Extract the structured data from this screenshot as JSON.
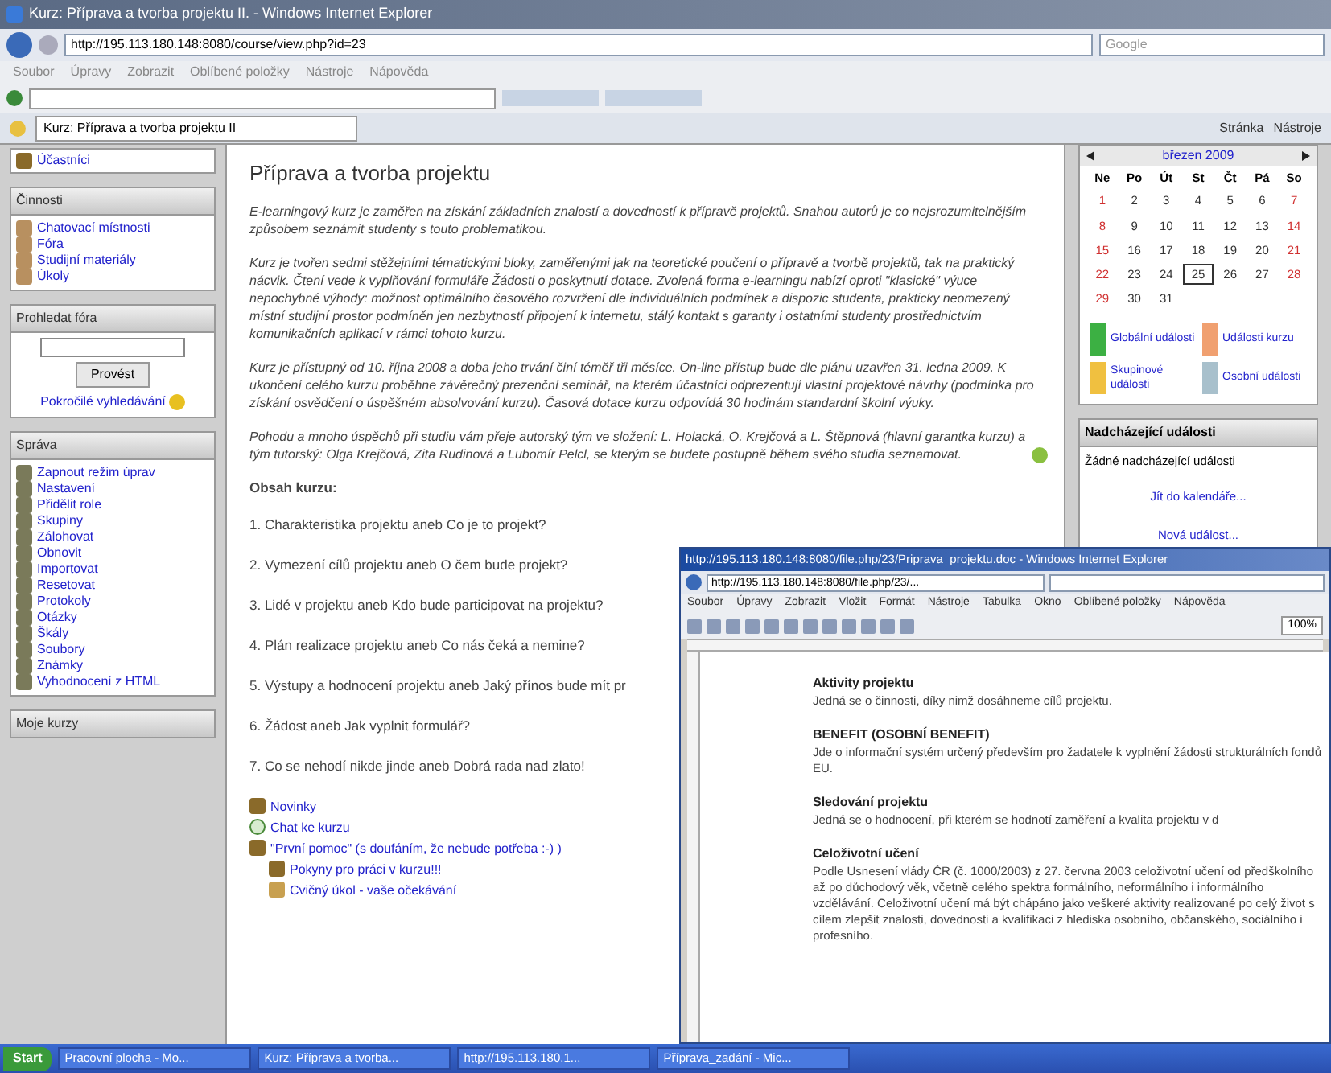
{
  "browser": {
    "title": "Kurz: Příprava a tvorba projektu II. - Windows Internet Explorer",
    "address": "http://195.113.180.148:8080/course/view.php?id=23",
    "search_placeholder": "Google",
    "menu": [
      "Soubor",
      "Úpravy",
      "Zobrazit",
      "Oblíbené položky",
      "Nástroje",
      "Nápověda"
    ],
    "tab": "Kurz: Příprava a tvorba projektu II",
    "command_bar": [
      "Stránka",
      "Nástroje"
    ]
  },
  "left": {
    "top_link": "Účastníci",
    "activities": {
      "title": "Činnosti",
      "items": [
        "Chatovací místnosti",
        "Fóra",
        "Studijní materiály",
        "Úkoly"
      ]
    },
    "search": {
      "title": "Prohledat fóra",
      "button": "Provést",
      "advanced": "Pokročilé vyhledávání"
    },
    "admin": {
      "title": "Správa",
      "items": [
        "Zapnout režim úprav",
        "Nastavení",
        "Přidělit role",
        "Skupiny",
        "Zálohovat",
        "Obnovit",
        "Importovat",
        "Resetovat",
        "Protokoly",
        "Otázky",
        "Škály",
        "Soubory",
        "Známky",
        "Vyhodnocení z HTML"
      ]
    },
    "my_courses": {
      "title": "Moje kurzy"
    }
  },
  "main": {
    "title": "Příprava a tvorba projektu",
    "paragraphs": [
      "E-learningový kurz je zaměřen na získání základních znalostí a dovedností k přípravě projektů. Snahou autorů je co nejsrozumitelnějším způsobem seznámit studenty s touto problematikou.",
      "Kurz je tvořen sedmi stěžejními tématickými bloky, zaměřenými jak na teoretické poučení o přípravě a tvorbě projektů, tak na praktický nácvik. Čtení vede k vyplňování formuláře Žádosti o poskytnutí dotace. Zvolená forma e-learningu nabízí oproti \"klasické\" výuce nepochybné výhody: možnost optimálního časového rozvržení dle individuálních podmínek a dispozic studenta, prakticky neomezený místní studijní prostor podmíněn jen nezbytností připojení k internetu, stálý kontakt s garanty i ostatními studenty prostřednictvím komunikačních aplikací v rámci tohoto kurzu.",
      "Kurz je přístupný od 10. října 2008 a doba jeho trvání činí téměř tři měsíce. On-line přístup bude dle plánu uzavřen 31. ledna 2009. K ukončení celého kurzu proběhne závěrečný prezenční seminář, na kterém účastníci odprezentují vlastní projektové návrhy (podmínka pro získání osvědčení o úspěšném absolvování kurzu). Časová dotace kurzu odpovídá 30 hodinám standardní školní výuky.",
      "Pohodu a mnoho úspěchů při studiu vám přeje autorský tým ve složení: L. Holacká, O. Krejčová a L. Štěpnová (hlavní garantka kurzu) a tým tutorský: Olga Krejčová, Zita Rudinová a Lubomír Pelcl, se kterým se budete postupně během svého studia seznamovat."
    ],
    "contents_title": "Obsah kurzu:",
    "topics": [
      "1. Charakteristika projektu aneb Co je to projekt?",
      "2. Vymezení cílů projektu aneb O čem bude projekt?",
      "3. Lidé v projektu aneb Kdo bude participovat na projektu?",
      "4. Plán realizace projektu aneb Co nás čeká a nemine?",
      "5. Výstupy a hodnocení projektu aneb Jaký přínos bude mít pr",
      "6. Žádost aneb Jak vyplnit formulář?",
      "7. Co se nehodí nikde jinde aneb Dobrá rada nad zlato!"
    ],
    "resources": [
      {
        "kind": "forum",
        "label": "Novinky"
      },
      {
        "kind": "chat",
        "label": "Chat ke kurzu"
      },
      {
        "kind": "forum",
        "label": "\"První pomoc\" (s doufáním, že nebude potřeba :-) )",
        "children": [
          {
            "kind": "forum",
            "label": "Pokyny pro práci v kurzu!!!"
          },
          {
            "kind": "assignment",
            "label": "Cvičný úkol - vaše očekávání"
          }
        ]
      }
    ]
  },
  "calendar": {
    "month": "březen 2009",
    "weekdays": [
      "Ne",
      "Po",
      "Út",
      "St",
      "Čt",
      "Pá",
      "So"
    ],
    "days": [
      {
        "d": "1",
        "weekend": true,
        "today": false
      },
      {
        "d": "2",
        "weekend": false,
        "today": false
      },
      {
        "d": "3",
        "weekend": false,
        "today": false
      },
      {
        "d": "4",
        "weekend": false,
        "today": false
      },
      {
        "d": "5",
        "weekend": false,
        "today": false
      },
      {
        "d": "6",
        "weekend": false,
        "today": false
      },
      {
        "d": "7",
        "weekend": true,
        "today": false
      },
      {
        "d": "8",
        "weekend": true,
        "today": false
      },
      {
        "d": "9",
        "weekend": false,
        "today": false
      },
      {
        "d": "10",
        "weekend": false,
        "today": false
      },
      {
        "d": "11",
        "weekend": false,
        "today": false
      },
      {
        "d": "12",
        "weekend": false,
        "today": false
      },
      {
        "d": "13",
        "weekend": false,
        "today": false
      },
      {
        "d": "14",
        "weekend": true,
        "today": false
      },
      {
        "d": "15",
        "weekend": true,
        "today": false
      },
      {
        "d": "16",
        "weekend": false,
        "today": false
      },
      {
        "d": "17",
        "weekend": false,
        "today": false
      },
      {
        "d": "18",
        "weekend": false,
        "today": false
      },
      {
        "d": "19",
        "weekend": false,
        "today": false
      },
      {
        "d": "20",
        "weekend": false,
        "today": false
      },
      {
        "d": "21",
        "weekend": true,
        "today": false
      },
      {
        "d": "22",
        "weekend": true,
        "today": false
      },
      {
        "d": "23",
        "weekend": false,
        "today": false
      },
      {
        "d": "24",
        "weekend": false,
        "today": false
      },
      {
        "d": "25",
        "weekend": false,
        "today": true
      },
      {
        "d": "26",
        "weekend": false,
        "today": false
      },
      {
        "d": "27",
        "weekend": false,
        "today": false
      },
      {
        "d": "28",
        "weekend": true,
        "today": false
      },
      {
        "d": "29",
        "weekend": true,
        "today": false
      },
      {
        "d": "30",
        "weekend": false,
        "today": false
      },
      {
        "d": "31",
        "weekend": false,
        "today": false
      }
    ],
    "legend": [
      {
        "label": "Globální události",
        "color": "#3cb043"
      },
      {
        "label": "Události kurzu",
        "color": "#f0a070"
      },
      {
        "label": "Skupinové události",
        "color": "#f0c040"
      },
      {
        "label": "Osobní události",
        "color": "#a8c0cc"
      }
    ]
  },
  "upcoming": {
    "title": "Nadcházející události",
    "empty": "Žádné nadcházející události",
    "links": [
      "Jít do kalendáře...",
      "Nová událost..."
    ]
  },
  "popup": {
    "title": "http://195.113.180.148:8080/file.php/23/Priprava_projektu.doc - Windows Internet Explorer",
    "address": "http://195.113.180.148:8080/file.php/23/...",
    "menu": [
      "Soubor",
      "Úpravy",
      "Zobrazit",
      "Vložit",
      "Formát",
      "Nástroje",
      "Tabulka",
      "Okno",
      "Oblíbené položky",
      "Nápověda"
    ],
    "zoom": "100%",
    "sections": [
      {
        "heading": "Aktivity projektu",
        "body": "Jedná se o činnosti, díky nimž dosáhneme cílů projektu."
      },
      {
        "heading": "BENEFIT (OSOBNÍ BENEFIT)",
        "body": "Jde o informační systém určený především pro žadatele k vyplnění žádosti strukturálních fondů EU."
      },
      {
        "heading": "Sledování projektu",
        "body": "Jedná se o hodnocení, při kterém se hodnotí zaměření a kvalita projektu v d"
      },
      {
        "heading": "Celoživotní učení",
        "body": "Podle Usnesení vlády ČR (č. 1000/2003) z 27. června 2003 celoživotní učení od předškolního až po důchodový věk, včetně celého spektra formálního, neformálního i informálního vzdělávání. Celoživotní učení má být chápáno jako veškeré aktivity realizované po celý život s cílem zlepšit znalosti, dovednosti a kvalifikaci z hlediska osobního, občanského, sociálního i profesního."
      }
    ]
  },
  "taskbar": {
    "start": "Start",
    "items": [
      "Pracovní plocha - Mo...",
      "Kurz: Příprava a tvorba...",
      "http://195.113.180.1...",
      "Příprava_zadání - Mic..."
    ]
  }
}
